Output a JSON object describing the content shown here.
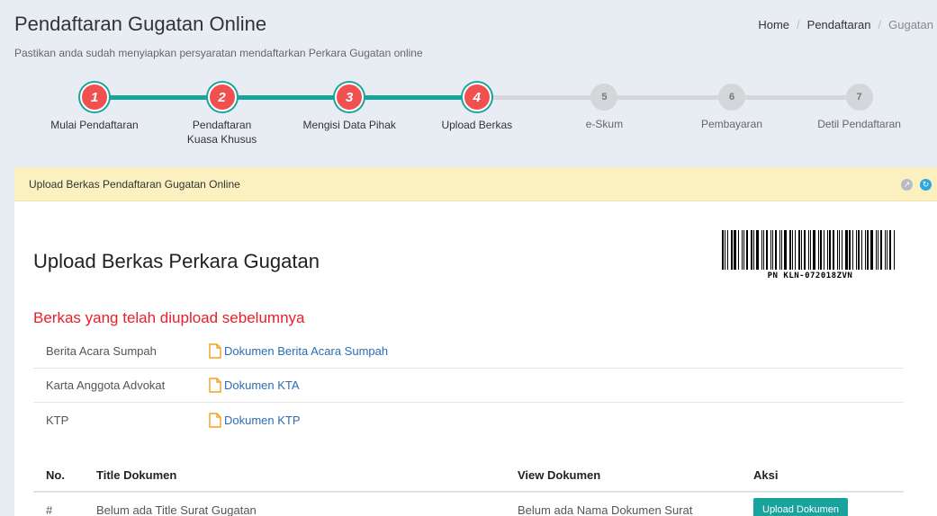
{
  "header": {
    "title": "Pendaftaran Gugatan Online",
    "subtitle": "Pastikan anda sudah menyiapkan persyaratan mendaftarkan Perkara Gugatan online",
    "breadcrumb": [
      "Home",
      "Pendaftaran",
      "Gugatan"
    ]
  },
  "wizard": {
    "steps": [
      {
        "number": "1",
        "label": "Mulai Pendaftaran",
        "done": true
      },
      {
        "number": "2",
        "label": "Pendaftaran Kuasa Khusus",
        "done": true
      },
      {
        "number": "3",
        "label": "Mengisi Data Pihak",
        "done": true
      },
      {
        "number": "4",
        "label": "Upload Berkas",
        "done": true
      },
      {
        "number": "5",
        "label": "e-Skum",
        "done": false
      },
      {
        "number": "6",
        "label": "Pembayaran",
        "done": false
      },
      {
        "number": "7",
        "label": "Detil Pendaftaran",
        "done": false
      }
    ],
    "done_color": "#19a39d",
    "circle_color": "#f05050",
    "todo_color": "#d4d6da"
  },
  "panel": {
    "heading": "Upload Berkas Pendaftaran Gugatan Online",
    "icons": [
      "collapse-icon",
      "refresh-icon"
    ],
    "title": "Upload Berkas Perkara Gugatan",
    "barcode_text": "PN KLN-072018ZVN",
    "uploaded_section_title": "Berkas yang telah diupload sebelumnya",
    "uploaded": [
      {
        "label": "Berita Acara Sumpah",
        "link": "Dokumen Berita Acara Sumpah"
      },
      {
        "label": "Karta Anggota Advokat",
        "link": "Dokumen KTA"
      },
      {
        "label": "KTP",
        "link": "Dokumen KTP"
      }
    ],
    "table": {
      "headers": {
        "no": "No.",
        "title": "Title Dokumen",
        "view": "View Dokumen",
        "aksi": "Aksi"
      },
      "rows": [
        {
          "no": "#",
          "title": "Belum ada Title Surat Gugatan",
          "view": "Belum ada Nama Dokumen Surat",
          "action": "Upload Dokumen"
        }
      ]
    }
  }
}
